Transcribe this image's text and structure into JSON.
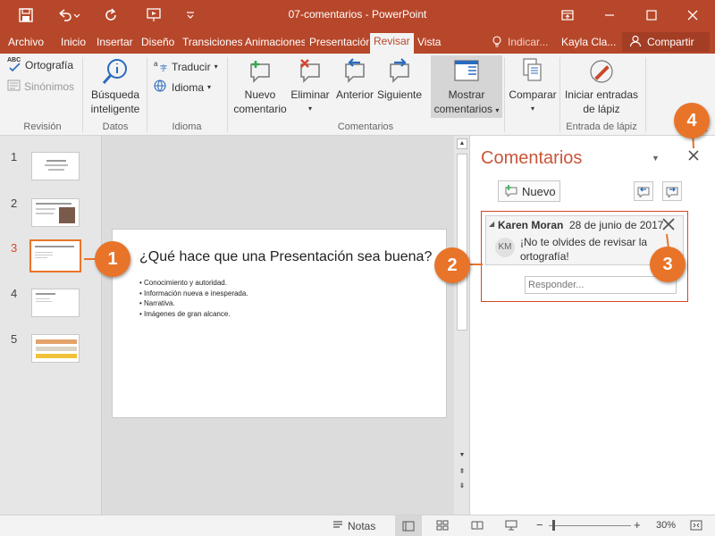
{
  "window": {
    "title": "07-comentarios  -  PowerPoint"
  },
  "tabs": [
    "Archivo",
    "Inicio",
    "Insertar",
    "Diseño",
    "Transiciones",
    "Animaciones",
    "Presentación",
    "Revisar",
    "Vista"
  ],
  "active_tab": "Revisar",
  "tell_me": "Indicar...",
  "user": "Kayla Cla...",
  "share": "Compartir",
  "ribbon": {
    "revision": {
      "label": "Revisión",
      "ortografia": "Ortografía",
      "sinonimos": "Sinónimos",
      "abc": "ABC"
    },
    "datos": {
      "label": "Datos",
      "busqueda_1": "Búsqueda",
      "busqueda_2": "inteligente"
    },
    "idioma": {
      "label": "Idioma",
      "traducir": "Traducir",
      "idioma": "Idioma"
    },
    "comentarios": {
      "label": "Comentarios",
      "nuevo_1": "Nuevo",
      "nuevo_2": "comentario",
      "eliminar": "Eliminar",
      "anterior": "Anterior",
      "siguiente": "Siguiente",
      "mostrar_1": "Mostrar",
      "mostrar_2": "comentarios"
    },
    "comparar": {
      "label": "Comparar"
    },
    "lapiz": {
      "label": "Entrada de lápiz",
      "btn_1": "Iniciar entradas",
      "btn_2": "de lápiz"
    }
  },
  "slides": [
    {
      "num": "1"
    },
    {
      "num": "2"
    },
    {
      "num": "3"
    },
    {
      "num": "4"
    },
    {
      "num": "5"
    }
  ],
  "selected_slide": 3,
  "slide": {
    "title": "¿Qué hace que una Presentación sea buena?",
    "bullets": [
      "Conocimiento y autoridad.",
      "Información nueva e inesperada.",
      "Narrativa.",
      "Imágenes de gran alcance."
    ]
  },
  "comments_pane": {
    "title": "Comentarios",
    "new_label": "Nuevo",
    "comment": {
      "author": "Karen Moran",
      "date": "28 de junio de 2017",
      "initials": "KM",
      "text_1": "¡No te olvides de revisar la",
      "text_2": "ortografía!"
    },
    "reply_placeholder": "Responder..."
  },
  "callouts": [
    "1",
    "2",
    "3",
    "4"
  ],
  "status": {
    "notes": "Notas",
    "zoom": "30%"
  },
  "colors": {
    "accent": "#b7472a",
    "callout": "#e8742a",
    "selection": "#e8742a"
  }
}
